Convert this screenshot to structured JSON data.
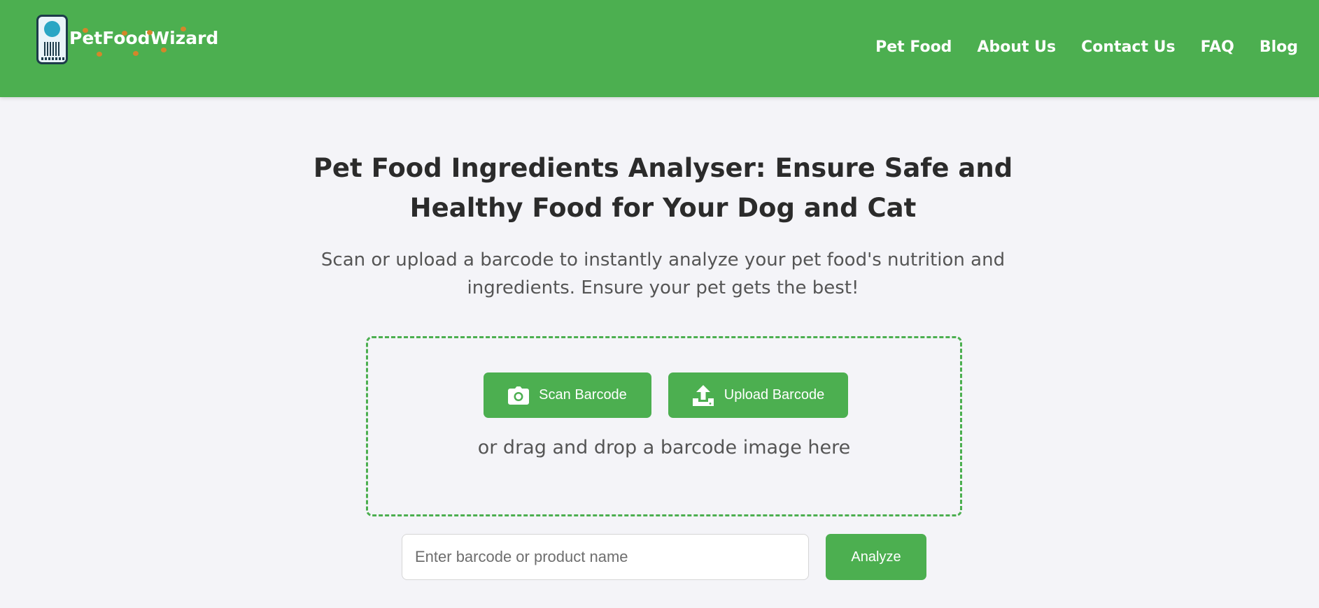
{
  "header": {
    "brand": "PetFoodWizard",
    "brand_color": "#4caf50",
    "nav": [
      {
        "label": "Pet Food"
      },
      {
        "label": "About Us"
      },
      {
        "label": "Contact Us"
      },
      {
        "label": "FAQ"
      },
      {
        "label": "Blog"
      }
    ]
  },
  "hero": {
    "title": "Pet Food Ingredients Analyser: Ensure Safe and Healthy Food for Your Dog and Cat",
    "subtitle": "Scan or upload a barcode to instantly analyze your pet food's nutrition and ingredients. Ensure your pet gets the best!"
  },
  "dropzone": {
    "scan_label": "Scan Barcode",
    "scan_icon": "camera-icon",
    "upload_label": "Upload Barcode",
    "upload_icon": "upload-icon",
    "drop_text": "or drag and drop a barcode image here"
  },
  "search": {
    "placeholder": "Enter barcode or product name",
    "value": "",
    "button_label": "Analyze"
  }
}
